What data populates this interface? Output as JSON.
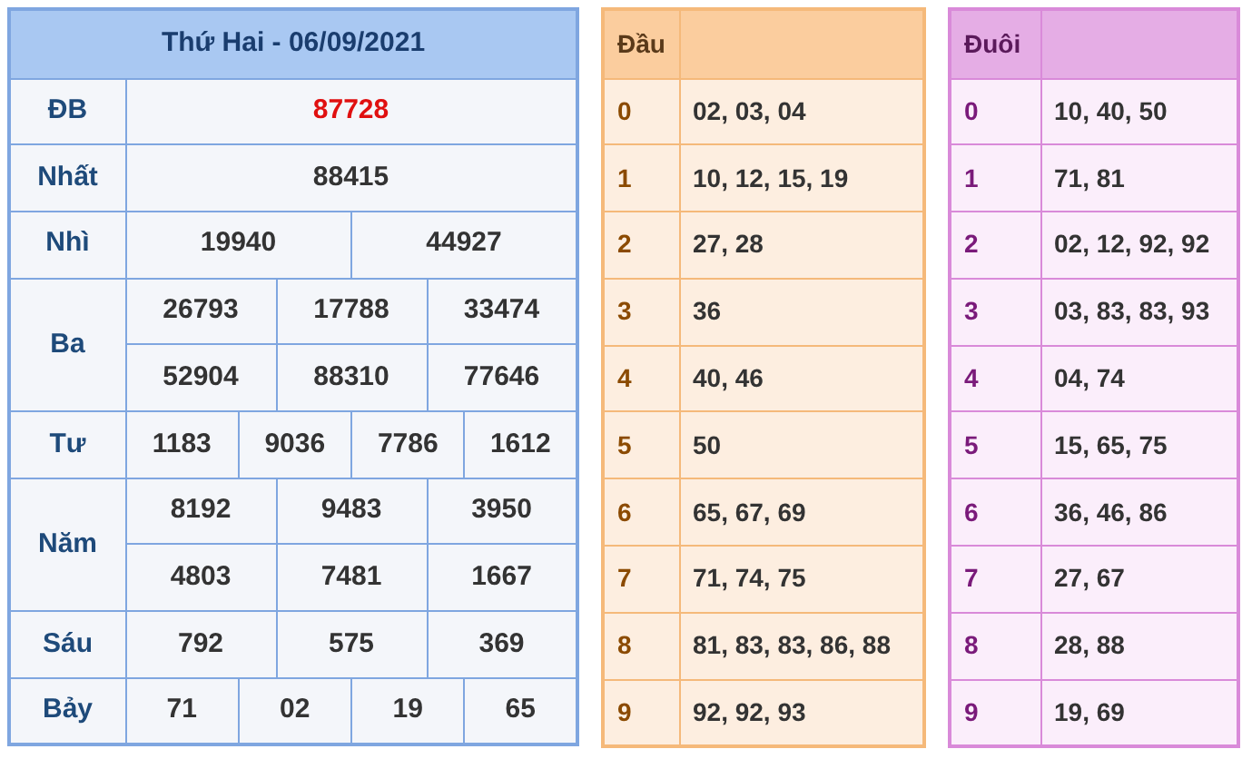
{
  "title": "Thứ Hai - 06/09/2021",
  "prizes": [
    {
      "label": "ĐB",
      "kind": "special",
      "rows": [
        [
          "87728"
        ]
      ]
    },
    {
      "label": "Nhất",
      "kind": "normal",
      "rows": [
        [
          "88415"
        ]
      ]
    },
    {
      "label": "Nhì",
      "kind": "normal",
      "rows": [
        [
          "19940",
          "44927"
        ]
      ]
    },
    {
      "label": "Ba",
      "kind": "normal",
      "rows": [
        [
          "26793",
          "17788",
          "33474"
        ],
        [
          "52904",
          "88310",
          "77646"
        ]
      ]
    },
    {
      "label": "Tư",
      "kind": "normal",
      "rows": [
        [
          "1183",
          "9036",
          "7786",
          "1612"
        ]
      ]
    },
    {
      "label": "Năm",
      "kind": "normal",
      "rows": [
        [
          "8192",
          "9483",
          "3950"
        ],
        [
          "4803",
          "7481",
          "1667"
        ]
      ]
    },
    {
      "label": "Sáu",
      "kind": "normal",
      "rows": [
        [
          "792",
          "575",
          "369"
        ]
      ]
    },
    {
      "label": "Bảy",
      "kind": "normal",
      "rows": [
        [
          "71",
          "02",
          "19",
          "65"
        ]
      ]
    }
  ],
  "dau": {
    "header": "Đầu",
    "rows": [
      {
        "digit": "0",
        "values": "02, 03, 04"
      },
      {
        "digit": "1",
        "values": "10, 12, 15, 19"
      },
      {
        "digit": "2",
        "values": "27, 28"
      },
      {
        "digit": "3",
        "values": "36"
      },
      {
        "digit": "4",
        "values": "40, 46"
      },
      {
        "digit": "5",
        "values": "50"
      },
      {
        "digit": "6",
        "values": "65, 67, 69"
      },
      {
        "digit": "7",
        "values": "71, 74, 75"
      },
      {
        "digit": "8",
        "values": "81, 83, 83, 86, 88"
      },
      {
        "digit": "9",
        "values": "92, 92, 93"
      }
    ]
  },
  "duoi": {
    "header": "Đuôi",
    "rows": [
      {
        "digit": "0",
        "values": "10, 40, 50"
      },
      {
        "digit": "1",
        "values": "71, 81"
      },
      {
        "digit": "2",
        "values": "02, 12, 92, 92"
      },
      {
        "digit": "3",
        "values": "03, 83, 83, 93"
      },
      {
        "digit": "4",
        "values": "04, 74"
      },
      {
        "digit": "5",
        "values": "15, 65, 75"
      },
      {
        "digit": "6",
        "values": "36, 46, 86"
      },
      {
        "digit": "7",
        "values": "27, 67"
      },
      {
        "digit": "8",
        "values": "28, 88"
      },
      {
        "digit": "9",
        "values": "19, 69"
      }
    ]
  }
}
